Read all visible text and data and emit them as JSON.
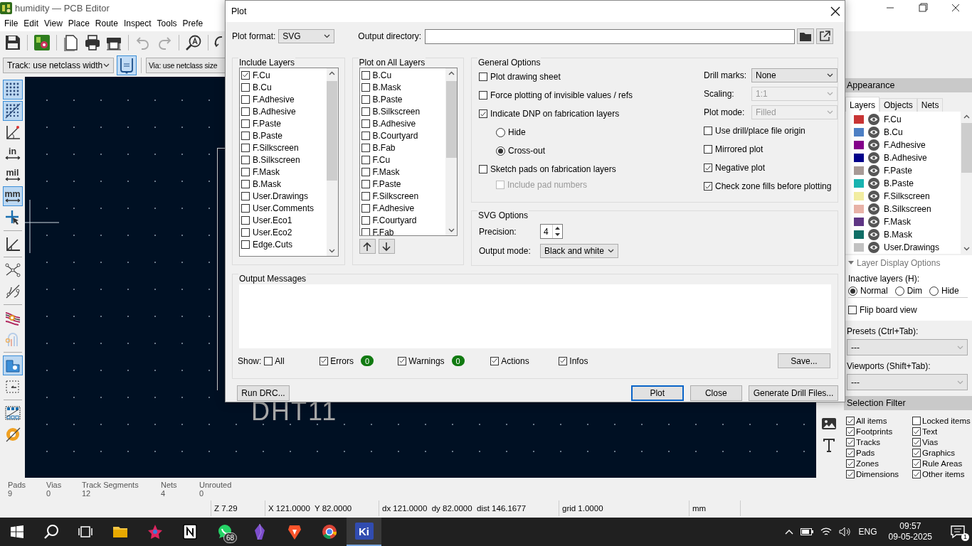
{
  "window": {
    "title": "humidity — PCB Editor"
  },
  "menu": [
    "File",
    "Edit",
    "View",
    "Place",
    "Route",
    "Inspect",
    "Tools",
    "Prefe"
  ],
  "toolbar": {
    "track_width": "Track: use netclass width",
    "via_size": "Via: use netclass size",
    "width_tool_selected": true
  },
  "left_toolbar": [
    {
      "kind": "grid",
      "selected": true
    },
    {
      "kind": "grid-overrides",
      "selected": true
    },
    {
      "kind": "polar",
      "selected": false
    },
    {
      "kind": "unit",
      "label": "in",
      "selected": false
    },
    {
      "kind": "unit",
      "label": "mil",
      "selected": false
    },
    {
      "kind": "unit",
      "label": "mm",
      "selected": true
    },
    {
      "kind": "cursor",
      "selected": false
    },
    {
      "kind": "origin",
      "selected": false
    },
    {
      "kind": "ratsnest",
      "selected": false
    },
    {
      "kind": "curved-ratsnest",
      "selected": false
    },
    {
      "kind": "net-colors",
      "selected": false
    },
    {
      "kind": "layer-colors",
      "selected": false
    },
    {
      "kind": "zone-fill",
      "selected": true
    },
    {
      "kind": "box-select",
      "selected": false
    },
    {
      "kind": "array",
      "selected": false
    },
    {
      "kind": "disc",
      "selected": false
    }
  ],
  "canvas": {
    "footprint_label": "DHT11"
  },
  "right_toolbar": [
    {
      "kind": "image"
    },
    {
      "kind": "text"
    }
  ],
  "appearance": {
    "title": "Appearance",
    "tabs": [
      {
        "label": "Layers",
        "selected": true
      },
      {
        "label": "Objects",
        "selected": false
      },
      {
        "label": "Nets",
        "selected": false
      }
    ],
    "layers": [
      {
        "name": "F.Cu",
        "color": "#c83434"
      },
      {
        "name": "B.Cu",
        "color": "#4d7fc4"
      },
      {
        "name": "F.Adhesive",
        "color": "#84008a"
      },
      {
        "name": "B.Adhesive",
        "color": "#02008a"
      },
      {
        "name": "F.Paste",
        "color": "#a89a96"
      },
      {
        "name": "B.Paste",
        "color": "#18b3b0"
      },
      {
        "name": "F.Silkscreen",
        "color": "#f2eda1"
      },
      {
        "name": "B.Silkscreen",
        "color": "#e8b2a7"
      },
      {
        "name": "F.Mask",
        "color": "#5e3584"
      },
      {
        "name": "B.Mask",
        "color": "#0f6e66"
      },
      {
        "name": "User.Drawings",
        "color": "#c2c2c2"
      }
    ],
    "display_options": {
      "title": "Layer Display Options",
      "expanded": true,
      "inactive_label": "Inactive layers (H):",
      "inactive_modes": [
        {
          "label": "Normal",
          "selected": true
        },
        {
          "label": "Dim",
          "selected": false
        },
        {
          "label": "Hide",
          "selected": false
        }
      ],
      "flip_board": {
        "label": "Flip board view",
        "checked": false
      }
    },
    "presets": {
      "label": "Presets (Ctrl+Tab):",
      "value": "---"
    },
    "viewports": {
      "label": "Viewports (Shift+Tab):",
      "value": "---"
    },
    "selection_filter": {
      "title": "Selection Filter",
      "items": [
        {
          "label": "All items",
          "checked": true
        },
        {
          "label": "Locked items",
          "checked": false
        },
        {
          "label": "Footprints",
          "checked": true
        },
        {
          "label": "Text",
          "checked": true
        },
        {
          "label": "Tracks",
          "checked": true
        },
        {
          "label": "Vias",
          "checked": true
        },
        {
          "label": "Pads",
          "checked": true
        },
        {
          "label": "Graphics",
          "checked": true
        },
        {
          "label": "Zones",
          "checked": true
        },
        {
          "label": "Rule Areas",
          "checked": true
        },
        {
          "label": "Dimensions",
          "checked": true
        },
        {
          "label": "Other items",
          "checked": true
        }
      ]
    }
  },
  "status": {
    "counts": [
      {
        "label": "Pads",
        "value": "9"
      },
      {
        "label": "Vias",
        "value": "0"
      },
      {
        "label": "Track Segments",
        "value": "12"
      },
      {
        "label": "Nets",
        "value": "4"
      },
      {
        "label": "Unrouted",
        "value": "0"
      }
    ],
    "fields": [
      "Z 7.29",
      "X 121.0000  Y 82.0000",
      "dx 121.0000  dy 82.0000  dist 146.1677",
      "grid 1.0000",
      "mm"
    ]
  },
  "dialog": {
    "title": "Plot",
    "plot_format": {
      "label": "Plot format:",
      "value": "SVG"
    },
    "output_directory": {
      "label": "Output directory:"
    },
    "include_layers": {
      "title": "Include Layers",
      "items": [
        {
          "label": "F.Cu",
          "checked": true
        },
        {
          "label": "B.Cu",
          "checked": false
        },
        {
          "label": "F.Adhesive",
          "checked": false
        },
        {
          "label": "B.Adhesive",
          "checked": false
        },
        {
          "label": "F.Paste",
          "checked": false
        },
        {
          "label": "B.Paste",
          "checked": false
        },
        {
          "label": "F.Silkscreen",
          "checked": false
        },
        {
          "label": "B.Silkscreen",
          "checked": false
        },
        {
          "label": "F.Mask",
          "checked": false
        },
        {
          "label": "B.Mask",
          "checked": false
        },
        {
          "label": "User.Drawings",
          "checked": false
        },
        {
          "label": "User.Comments",
          "checked": false
        },
        {
          "label": "User.Eco1",
          "checked": false
        },
        {
          "label": "User.Eco2",
          "checked": false
        },
        {
          "label": "Edge.Cuts",
          "checked": false
        }
      ]
    },
    "plot_on_all_layers": {
      "title": "Plot on All Layers",
      "items": [
        {
          "label": "B.Cu",
          "checked": false
        },
        {
          "label": "B.Mask",
          "checked": false
        },
        {
          "label": "B.Paste",
          "checked": false
        },
        {
          "label": "B.Silkscreen",
          "checked": false
        },
        {
          "label": "B.Adhesive",
          "checked": false
        },
        {
          "label": "B.Courtyard",
          "checked": false
        },
        {
          "label": "B.Fab",
          "checked": false
        },
        {
          "label": "F.Cu",
          "checked": false
        },
        {
          "label": "F.Mask",
          "checked": false
        },
        {
          "label": "F.Paste",
          "checked": false
        },
        {
          "label": "F.Silkscreen",
          "checked": false
        },
        {
          "label": "F.Adhesive",
          "checked": false
        },
        {
          "label": "F.Courtyard",
          "checked": false
        },
        {
          "label": "F.Fab",
          "checked": false
        }
      ]
    },
    "general_options": {
      "title": "General Options",
      "left": [
        {
          "kind": "checkbox",
          "label": "Plot drawing sheet",
          "checked": false,
          "disabled": false
        },
        {
          "kind": "checkbox",
          "label": "Force plotting of invisible values / refs",
          "checked": false,
          "disabled": false
        },
        {
          "kind": "checkbox",
          "label": "Indicate DNP on fabrication layers",
          "checked": true,
          "disabled": false
        },
        {
          "kind": "radio",
          "label": "Hide",
          "selected": false
        },
        {
          "kind": "radio",
          "label": "Cross-out",
          "selected": true
        },
        {
          "kind": "checkbox",
          "label": "Sketch pads on fabrication layers",
          "checked": false,
          "disabled": false
        },
        {
          "kind": "sub-checkbox",
          "label": "Include pad numbers",
          "checked": false,
          "disabled": true
        }
      ],
      "fields": [
        {
          "label": "Drill marks:",
          "value": "None",
          "disabled": false
        },
        {
          "label": "Scaling:",
          "value": "1:1",
          "disabled": true
        },
        {
          "label": "Plot mode:",
          "value": "Filled",
          "disabled": true
        }
      ],
      "right": [
        {
          "label": "Use drill/place file origin",
          "checked": false
        },
        {
          "label": "Mirrored plot",
          "checked": false
        },
        {
          "label": "Negative plot",
          "checked": true
        },
        {
          "label": "Check zone fills before plotting",
          "checked": true
        }
      ]
    },
    "svg_options": {
      "title": "SVG Options",
      "precision_label": "Precision:",
      "precision": "4",
      "output_mode_label": "Output mode:",
      "output_mode": "Black and white"
    },
    "output_messages": {
      "title": "Output Messages",
      "show_label": "Show:",
      "filters": [
        {
          "label": "All",
          "checked": false
        },
        {
          "label": "Errors",
          "checked": true,
          "count": "0"
        },
        {
          "label": "Warnings",
          "checked": true,
          "count": "0"
        },
        {
          "label": "Actions",
          "checked": true
        },
        {
          "label": "Infos",
          "checked": true
        }
      ],
      "save": "Save..."
    },
    "buttons": [
      {
        "label": "Run DRC...",
        "default": false
      },
      {
        "label": "Plot",
        "default": true
      },
      {
        "label": "Close",
        "default": false
      },
      {
        "label": "Generate Drill Files...",
        "default": false
      }
    ]
  },
  "taskbar": {
    "apps": [
      {
        "kind": "files",
        "active": false
      },
      {
        "kind": "star",
        "active": false
      },
      {
        "kind": "notion",
        "active": false
      },
      {
        "kind": "chat",
        "active": false,
        "badge": "68"
      },
      {
        "kind": "gem",
        "active": false
      },
      {
        "kind": "lion",
        "active": false
      },
      {
        "kind": "browser",
        "active": false
      },
      {
        "kind": "kicad",
        "active": true,
        "label": "Ki"
      }
    ],
    "language": "ENG",
    "time": "09:57",
    "date": "09-05-2025",
    "notifications": "1"
  }
}
